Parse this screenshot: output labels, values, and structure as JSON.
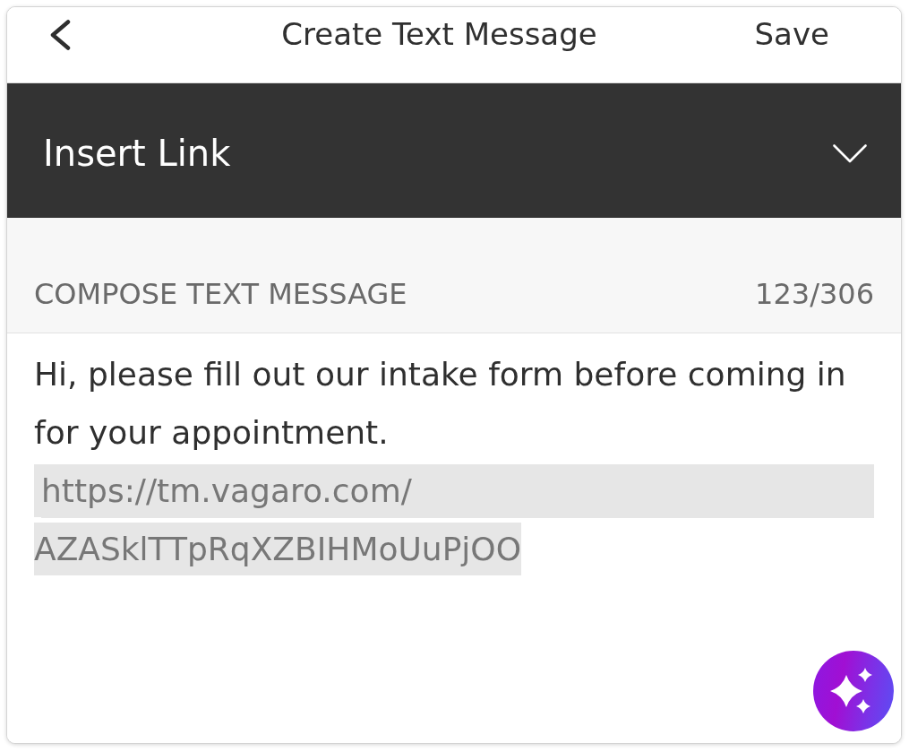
{
  "nav_bar": {
    "title": "Create Text Message",
    "action": "Save"
  },
  "dropdown": {
    "label": "Insert Link",
    "expanded": false
  },
  "compose": {
    "label": "COMPOSE TEXT MESSAGE",
    "counter": "123/306",
    "message": "Hi, please fill out our intake form before coming in for your appointment.",
    "link": "https://tm.vagaro.com/AZASklTTpRqXZBIHMoUuPjOO"
  }
}
